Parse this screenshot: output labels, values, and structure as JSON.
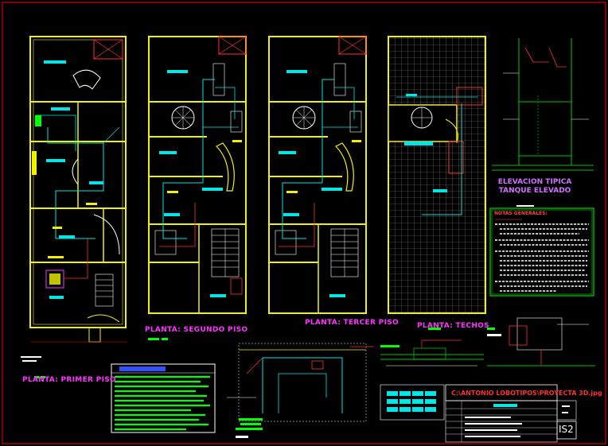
{
  "plans": {
    "first_floor": "PLANTA: PRIMER PISO",
    "second_floor": "PLANTA: SEGUNDO PISO",
    "third_floor": "PLANTA: TERCER PISO",
    "roof": "PLANTA: TECHOS"
  },
  "elevation": {
    "line1": "ELEVACION TIPICA",
    "line2": "TANQUE ELEVADO"
  },
  "notes": {
    "title": "NOTAS GENERALES:"
  },
  "title_block": {
    "file_path": "C:\\ANTONIO LOBOTIPOS\\PROYECTA 3D.jpg",
    "sheet_number": "IS2"
  },
  "colors": {
    "background": "#000000",
    "walls": "#f2f200",
    "water_lines": "#00e5e5",
    "labels": "#00ffff",
    "green_text": "#00ff00",
    "magenta": "#ff33ff",
    "red": "#ff0000",
    "white": "#ffffff"
  }
}
